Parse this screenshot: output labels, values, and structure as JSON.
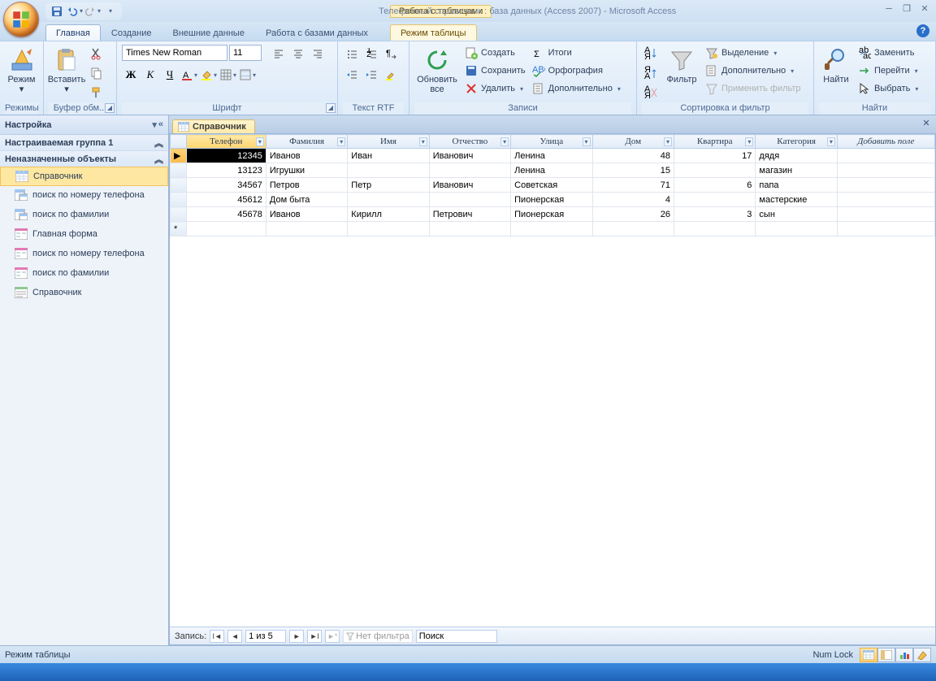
{
  "titlebar": {
    "context_tool": "Работа с таблицами",
    "title": "Телефонный справочник : база данных (Access 2007) - Microsoft Access"
  },
  "tabs": {
    "items": [
      "Главная",
      "Создание",
      "Внешние данные",
      "Работа с базами данных"
    ],
    "context": "Режим таблицы",
    "active_index": 0
  },
  "ribbon": {
    "views": {
      "label": "Режимы",
      "mode": "Режим"
    },
    "clipboard": {
      "label": "Буфер обм...",
      "paste": "Вставить"
    },
    "font": {
      "label": "Шрифт",
      "family": "Times New Roman",
      "size": "11"
    },
    "rtf": {
      "label": "Текст RTF"
    },
    "records": {
      "label": "Записи",
      "refresh": "Обновить\nвсе",
      "create": "Создать",
      "save": "Сохранить",
      "delete": "Удалить",
      "totals": "Итоги",
      "spelling": "Орфография",
      "more": "Дополнительно"
    },
    "sortfilter": {
      "label": "Сортировка и фильтр",
      "filter": "Фильтр",
      "selection": "Выделение",
      "advanced": "Дополнительно",
      "apply": "Применить фильтр"
    },
    "find": {
      "label": "Найти",
      "find": "Найти",
      "replace": "Заменить",
      "goto": "Перейти",
      "select": "Выбрать"
    }
  },
  "nav": {
    "title": "Настройка",
    "group1": "Настраиваемая группа 1",
    "group2": "Неназначенные объекты",
    "items": [
      {
        "type": "table",
        "label": "Справочник"
      },
      {
        "type": "query",
        "label": "поиск по номеру телефона"
      },
      {
        "type": "query",
        "label": "поиск по фамилии"
      },
      {
        "type": "form",
        "label": "Главная форма"
      },
      {
        "type": "form",
        "label": "поиск по номеру телефона"
      },
      {
        "type": "form",
        "label": "поиск по фамилии"
      },
      {
        "type": "report",
        "label": "Справочник"
      }
    ],
    "selected_index": 0
  },
  "doc": {
    "tab": "Справочник",
    "columns": [
      "Телефон",
      "Фамилия",
      "Имя",
      "Отчество",
      "Улица",
      "Дом",
      "Квартира",
      "Категория"
    ],
    "add_field": "Добавить поле",
    "rows": [
      {
        "Телефон": "12345",
        "Фамилия": "Иванов",
        "Имя": "Иван",
        "Отчество": "Иванович",
        "Улица": "Ленина",
        "Дом": "48",
        "Квартира": "17",
        "Категория": "дядя"
      },
      {
        "Телефон": "13123",
        "Фамилия": "Игрушки",
        "Имя": "",
        "Отчество": "",
        "Улица": "Ленина",
        "Дом": "15",
        "Квартира": "",
        "Категория": "магазин"
      },
      {
        "Телефон": "34567",
        "Фамилия": "Петров",
        "Имя": "Петр",
        "Отчество": "Иванович",
        "Улица": "Советская",
        "Дом": "71",
        "Квартира": "6",
        "Категория": "папа"
      },
      {
        "Телефон": "45612",
        "Фамилия": "Дом быта",
        "Имя": "",
        "Отчество": "",
        "Улица": "Пионерская",
        "Дом": "4",
        "Квартира": "",
        "Категория": "мастерские"
      },
      {
        "Телефон": "45678",
        "Фамилия": "Иванов",
        "Имя": "Кирилл",
        "Отчество": "Петрович",
        "Улица": "Пионерская",
        "Дом": "26",
        "Квартира": "3",
        "Категория": "сын"
      }
    ],
    "selected_row": 0,
    "selected_col": 0
  },
  "recnav": {
    "label": "Запись:",
    "pos": "1 из 5",
    "no_filter": "Нет фильтра",
    "search": "Поиск"
  },
  "status": {
    "mode": "Режим таблицы",
    "numlock": "Num Lock"
  }
}
